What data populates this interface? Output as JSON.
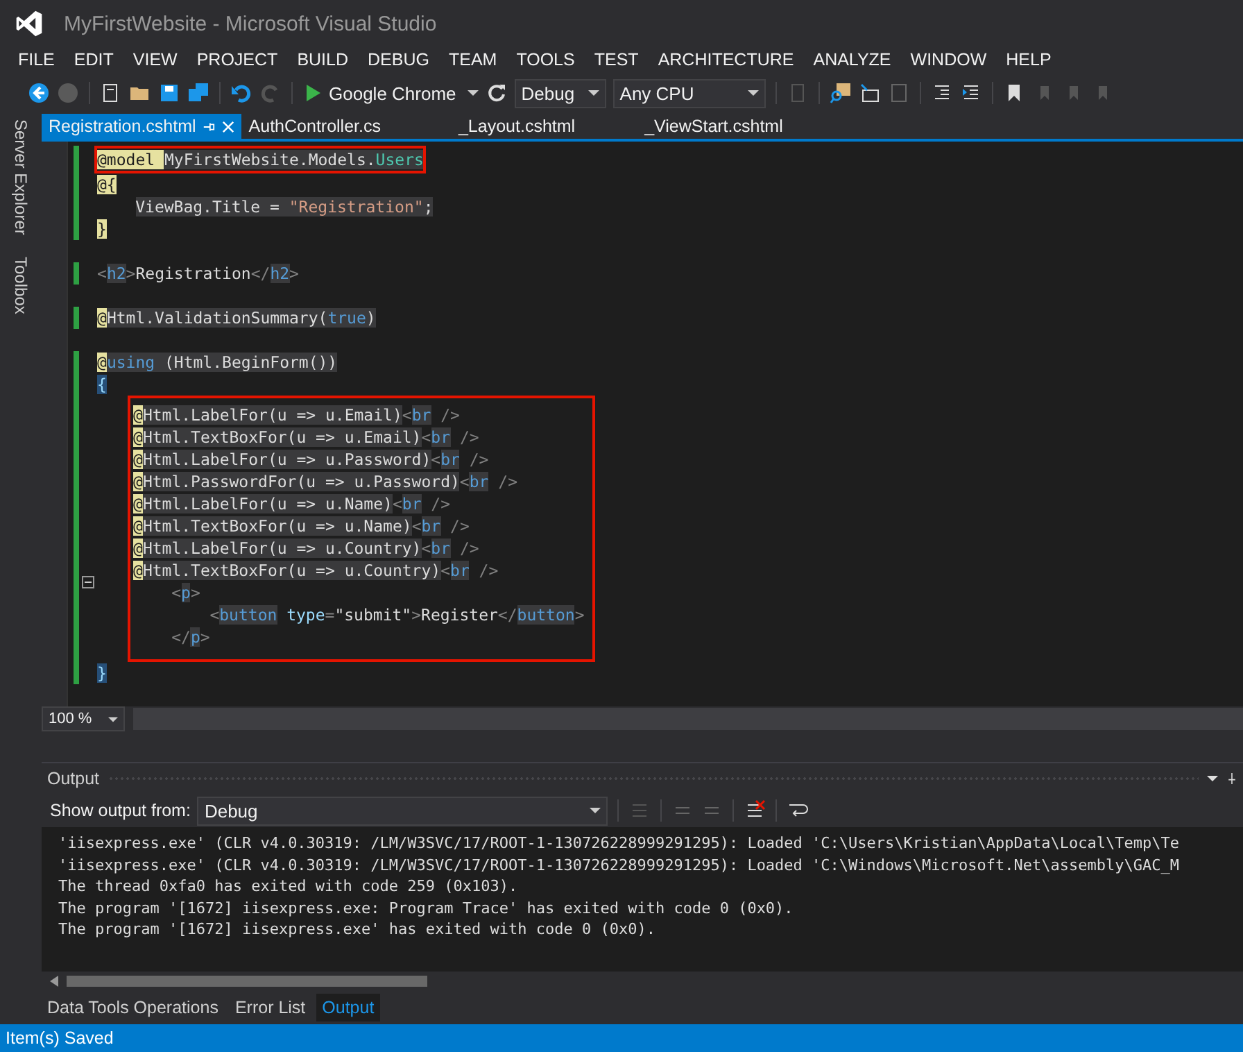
{
  "window": {
    "title": "MyFirstWebsite - Microsoft Visual Studio"
  },
  "menu": [
    "FILE",
    "EDIT",
    "VIEW",
    "PROJECT",
    "BUILD",
    "DEBUG",
    "TEAM",
    "TOOLS",
    "TEST",
    "ARCHITECTURE",
    "ANALYZE",
    "WINDOW",
    "HELP"
  ],
  "toolbar": {
    "run_target": "Google Chrome",
    "configuration": "Debug",
    "platform": "Any CPU"
  },
  "side_tabs": [
    "Server Explorer",
    "Toolbox"
  ],
  "tabs": [
    {
      "label": "Registration.cshtml",
      "selected": true
    },
    {
      "label": "AuthController.cs",
      "selected": false
    },
    {
      "label": "_Layout.cshtml",
      "selected": false
    },
    {
      "label": "_ViewStart.cshtml",
      "selected": false
    }
  ],
  "code": [
    {
      "boxed": true,
      "changed": true,
      "lines": [
        {
          "tokens": [
            {
              "kind": "at",
              "text": "@model "
            },
            {
              "kind": "plain",
              "text": "MyFirstWebsite.Models."
            },
            {
              "kind": "type",
              "text": "Users"
            }
          ]
        }
      ]
    },
    {
      "boxed": false,
      "changed": true,
      "lines": [
        {
          "tokens": [
            {
              "kind": "at",
              "text": "@{"
            }
          ]
        },
        {
          "kind": "indent1",
          "tokens": [
            {
              "kind": "plain",
              "text": "ViewBag.Title = "
            },
            {
              "kind": "str",
              "text": "\"Registration\""
            },
            {
              "kind": "plain",
              "text": ";"
            }
          ]
        },
        {
          "tokens": [
            {
              "kind": "at",
              "text": "}"
            }
          ]
        }
      ]
    },
    {
      "blank_line_before": true,
      "boxed": false,
      "changed": true,
      "lines": [
        {
          "tokens": [
            {
              "kind": "tag",
              "text": "<"
            },
            {
              "kind": "kw",
              "text": "h2"
            },
            {
              "kind": "tag",
              "text": ">"
            },
            {
              "kind": "text",
              "text": "Registration"
            },
            {
              "kind": "tag",
              "text": "</"
            },
            {
              "kind": "kw",
              "text": "h2"
            },
            {
              "kind": "tag",
              "text": ">"
            }
          ]
        }
      ]
    },
    {
      "blank_line_before": true,
      "boxed": false,
      "changed": true,
      "lines": [
        {
          "tokens": [
            {
              "kind": "at",
              "text": "@"
            },
            {
              "kind": "plain",
              "text": "Html.ValidationSummary("
            },
            {
              "kind": "kw",
              "text": "true"
            },
            {
              "kind": "plain",
              "text": ")"
            }
          ]
        }
      ]
    },
    {
      "blank_line_before": true,
      "boxed": false,
      "changed": true,
      "lines": [
        {
          "tokens": [
            {
              "kind": "at",
              "text": "@"
            },
            {
              "kind": "kw",
              "text": "using"
            },
            {
              "kind": "plain",
              "text": " (Html.BeginForm())"
            }
          ]
        },
        {
          "tokens": [
            {
              "kind": "brace",
              "text": "{"
            }
          ]
        }
      ]
    },
    {
      "boxed": true,
      "changed": true,
      "lines": [
        {
          "tokens": [
            {
              "kind": "at",
              "text": "@"
            },
            {
              "kind": "plain",
              "text": "Html.LabelFor(u => u.Email)"
            },
            {
              "kind": "tag",
              "text": "<"
            },
            {
              "kind": "kw",
              "text": "br"
            },
            {
              "kind": "tag",
              "text": " />"
            }
          ]
        },
        {
          "tokens": [
            {
              "kind": "at",
              "text": "@"
            },
            {
              "kind": "plain",
              "text": "Html.TextBoxFor(u => u.Email)"
            },
            {
              "kind": "tag",
              "text": "<"
            },
            {
              "kind": "kw",
              "text": "br"
            },
            {
              "kind": "tag",
              "text": " />"
            }
          ]
        },
        {
          "tokens": [
            {
              "kind": "at",
              "text": "@"
            },
            {
              "kind": "plain",
              "text": "Html.LabelFor(u => u.Password)"
            },
            {
              "kind": "tag",
              "text": "<"
            },
            {
              "kind": "kw",
              "text": "br"
            },
            {
              "kind": "tag",
              "text": " />"
            }
          ]
        },
        {
          "tokens": [
            {
              "kind": "at",
              "text": "@"
            },
            {
              "kind": "plain",
              "text": "Html.PasswordFor(u => u.Password)"
            },
            {
              "kind": "tag",
              "text": "<"
            },
            {
              "kind": "kw",
              "text": "br"
            },
            {
              "kind": "tag",
              "text": " />"
            }
          ]
        },
        {
          "tokens": [
            {
              "kind": "at",
              "text": "@"
            },
            {
              "kind": "plain",
              "text": "Html.LabelFor(u => u.Name)"
            },
            {
              "kind": "tag",
              "text": "<"
            },
            {
              "kind": "kw",
              "text": "br"
            },
            {
              "kind": "tag",
              "text": " />"
            }
          ]
        },
        {
          "tokens": [
            {
              "kind": "at",
              "text": "@"
            },
            {
              "kind": "plain",
              "text": "Html.TextBoxFor(u => u.Name)"
            },
            {
              "kind": "tag",
              "text": "<"
            },
            {
              "kind": "kw",
              "text": "br"
            },
            {
              "kind": "tag",
              "text": " />"
            }
          ]
        },
        {
          "tokens": [
            {
              "kind": "at",
              "text": "@"
            },
            {
              "kind": "plain",
              "text": "Html.LabelFor(u => u.Country)"
            },
            {
              "kind": "tag",
              "text": "<"
            },
            {
              "kind": "kw",
              "text": "br"
            },
            {
              "kind": "tag",
              "text": " />"
            }
          ]
        },
        {
          "tokens": [
            {
              "kind": "at",
              "text": "@"
            },
            {
              "kind": "plain",
              "text": "Html.TextBoxFor(u => u.Country)"
            },
            {
              "kind": "tag",
              "text": "<"
            },
            {
              "kind": "kw",
              "text": "br"
            },
            {
              "kind": "tag",
              "text": " />"
            }
          ]
        },
        {
          "kind": "indent1",
          "tokens": [
            {
              "kind": "tag",
              "text": "<"
            },
            {
              "kind": "kw",
              "text": "p"
            },
            {
              "kind": "tag",
              "text": ">"
            }
          ]
        },
        {
          "kind": "indent2",
          "tokens": [
            {
              "kind": "tag",
              "text": "<"
            },
            {
              "kind": "kw",
              "text": "button"
            },
            {
              "kind": "attr",
              "text": "type"
            },
            {
              "kind": "tag",
              "text": "="
            },
            {
              "kind": "text",
              "text": "\"submit\""
            },
            {
              "kind": "tag",
              "text": ">"
            },
            {
              "kind": "text",
              "text": "Register"
            },
            {
              "kind": "tag",
              "text": "</"
            },
            {
              "kind": "kw",
              "text": "button"
            },
            {
              "kind": "tag",
              "text": ">"
            }
          ]
        },
        {
          "kind": "indent1",
          "tokens": [
            {
              "kind": "tag",
              "text": "</"
            },
            {
              "kind": "kw",
              "text": "p"
            },
            {
              "kind": "tag",
              "text": ">"
            }
          ]
        }
      ]
    },
    {
      "boxed": false,
      "changed": true,
      "lines": [
        {
          "tokens": [
            {
              "kind": "brace",
              "text": "}"
            }
          ]
        }
      ]
    }
  ],
  "zoom": "100 %",
  "output": {
    "title": "Output",
    "source_label": "Show output from:",
    "source": "Debug",
    "lines": [
      "'iisexpress.exe' (CLR v4.0.30319: /LM/W3SVC/17/ROOT-1-130726228999291295): Loaded 'C:\\Users\\Kristian\\AppData\\Local\\Temp\\Te",
      "'iisexpress.exe' (CLR v4.0.30319: /LM/W3SVC/17/ROOT-1-130726228999291295): Loaded 'C:\\Windows\\Microsoft.Net\\assembly\\GAC_M",
      "The thread 0xfa0 has exited with code 259 (0x103).",
      "The program '[1672] iisexpress.exe: Program Trace' has exited with code 0 (0x0).",
      "The program '[1672] iisexpress.exe' has exited with code 0 (0x0)."
    ]
  },
  "bottom_tabs": [
    {
      "label": "Data Tools Operations",
      "selected": false
    },
    {
      "label": "Error List",
      "selected": false
    },
    {
      "label": "Output",
      "selected": true
    }
  ],
  "status_bar": "Item(s) Saved"
}
